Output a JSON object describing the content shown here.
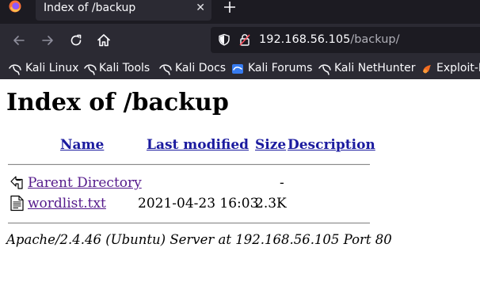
{
  "browser": {
    "tab": {
      "title": "Index of /backup",
      "close_glyph": "✕"
    },
    "new_tab_icon": "plus-icon",
    "url": {
      "host": "192.168.56.105",
      "path": "/backup/"
    },
    "colors": {
      "chrome_dark": "#1c1b22",
      "chrome": "#2b2a33",
      "text": "#fbfbfe"
    }
  },
  "bookmarks": [
    {
      "label": "Kali Linux",
      "icon": "kali-dragon-icon"
    },
    {
      "label": "Kali Tools",
      "icon": "kali-dragon-icon"
    },
    {
      "label": "Kali Docs",
      "icon": "kali-dragon-icon"
    },
    {
      "label": "Kali Forums",
      "icon": "kali-forums-icon"
    },
    {
      "label": "Kali NetHunter",
      "icon": "kali-dragon-icon"
    },
    {
      "label": "Exploit-DB",
      "icon": "exploit-db-icon"
    }
  ],
  "page": {
    "heading": "Index of /backup",
    "columns": {
      "name": "Name",
      "last_modified": "Last modified",
      "size": "Size",
      "description": "Description"
    },
    "rows": [
      {
        "icon": "back-arrow-icon",
        "name": "Parent Directory",
        "last_modified": "",
        "size": "-",
        "description": ""
      },
      {
        "icon": "text-file-icon",
        "name": "wordlist.txt",
        "last_modified": "2021-04-23 16:03",
        "size": "2.3K",
        "description": ""
      }
    ],
    "address": "Apache/2.4.46 (Ubuntu) Server at 192.168.56.105 Port 80",
    "colors": {
      "header_link": "#1b1b9f",
      "visited_link": "#551a8b"
    }
  }
}
